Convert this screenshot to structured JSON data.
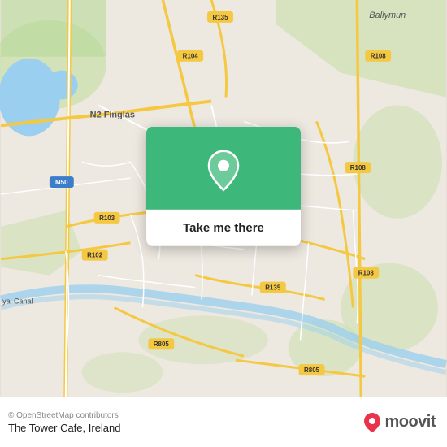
{
  "map": {
    "alt": "Map of Dublin, Ireland showing The Tower Cafe area"
  },
  "popup": {
    "button_label": "Take me there"
  },
  "bottom_bar": {
    "copyright": "© OpenStreetMap contributors",
    "place_name": "The Tower Cafe, Ireland"
  },
  "moovit": {
    "logo_text": "moovit"
  },
  "road_labels": [
    {
      "id": "r135_top",
      "label": "R135"
    },
    {
      "id": "r104",
      "label": "R104"
    },
    {
      "id": "r108_top",
      "label": "R108"
    },
    {
      "id": "r108_mid",
      "label": "R108"
    },
    {
      "id": "r108_bot",
      "label": "R108"
    },
    {
      "id": "r103",
      "label": "R103"
    },
    {
      "id": "r135_mid",
      "label": "R135"
    },
    {
      "id": "r135_bot",
      "label": "R135"
    },
    {
      "id": "r102",
      "label": "R102"
    },
    {
      "id": "r805_left",
      "label": "R805"
    },
    {
      "id": "r805_right",
      "label": "R805"
    },
    {
      "id": "m50",
      "label": "M50"
    },
    {
      "id": "n2",
      "label": "N2 Finglas"
    },
    {
      "id": "ballymun",
      "label": "Ballymun"
    },
    {
      "id": "canal",
      "label": "yal Canal"
    }
  ]
}
